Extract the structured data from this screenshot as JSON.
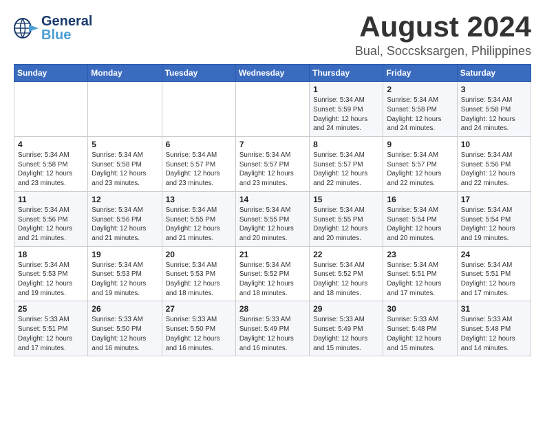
{
  "header": {
    "logo_general": "General",
    "logo_blue": "Blue",
    "main_title": "August 2024",
    "subtitle": "Bual, Soccsksargen, Philippines"
  },
  "days_of_week": [
    "Sunday",
    "Monday",
    "Tuesday",
    "Wednesday",
    "Thursday",
    "Friday",
    "Saturday"
  ],
  "weeks": [
    {
      "days": [
        {
          "number": "",
          "info": ""
        },
        {
          "number": "",
          "info": ""
        },
        {
          "number": "",
          "info": ""
        },
        {
          "number": "",
          "info": ""
        },
        {
          "number": "1",
          "info": "Sunrise: 5:34 AM\nSunset: 5:59 PM\nDaylight: 12 hours\nand 24 minutes."
        },
        {
          "number": "2",
          "info": "Sunrise: 5:34 AM\nSunset: 5:58 PM\nDaylight: 12 hours\nand 24 minutes."
        },
        {
          "number": "3",
          "info": "Sunrise: 5:34 AM\nSunset: 5:58 PM\nDaylight: 12 hours\nand 24 minutes."
        }
      ]
    },
    {
      "days": [
        {
          "number": "4",
          "info": "Sunrise: 5:34 AM\nSunset: 5:58 PM\nDaylight: 12 hours\nand 23 minutes."
        },
        {
          "number": "5",
          "info": "Sunrise: 5:34 AM\nSunset: 5:58 PM\nDaylight: 12 hours\nand 23 minutes."
        },
        {
          "number": "6",
          "info": "Sunrise: 5:34 AM\nSunset: 5:57 PM\nDaylight: 12 hours\nand 23 minutes."
        },
        {
          "number": "7",
          "info": "Sunrise: 5:34 AM\nSunset: 5:57 PM\nDaylight: 12 hours\nand 23 minutes."
        },
        {
          "number": "8",
          "info": "Sunrise: 5:34 AM\nSunset: 5:57 PM\nDaylight: 12 hours\nand 22 minutes."
        },
        {
          "number": "9",
          "info": "Sunrise: 5:34 AM\nSunset: 5:57 PM\nDaylight: 12 hours\nand 22 minutes."
        },
        {
          "number": "10",
          "info": "Sunrise: 5:34 AM\nSunset: 5:56 PM\nDaylight: 12 hours\nand 22 minutes."
        }
      ]
    },
    {
      "days": [
        {
          "number": "11",
          "info": "Sunrise: 5:34 AM\nSunset: 5:56 PM\nDaylight: 12 hours\nand 21 minutes."
        },
        {
          "number": "12",
          "info": "Sunrise: 5:34 AM\nSunset: 5:56 PM\nDaylight: 12 hours\nand 21 minutes."
        },
        {
          "number": "13",
          "info": "Sunrise: 5:34 AM\nSunset: 5:55 PM\nDaylight: 12 hours\nand 21 minutes."
        },
        {
          "number": "14",
          "info": "Sunrise: 5:34 AM\nSunset: 5:55 PM\nDaylight: 12 hours\nand 20 minutes."
        },
        {
          "number": "15",
          "info": "Sunrise: 5:34 AM\nSunset: 5:55 PM\nDaylight: 12 hours\nand 20 minutes."
        },
        {
          "number": "16",
          "info": "Sunrise: 5:34 AM\nSunset: 5:54 PM\nDaylight: 12 hours\nand 20 minutes."
        },
        {
          "number": "17",
          "info": "Sunrise: 5:34 AM\nSunset: 5:54 PM\nDaylight: 12 hours\nand 19 minutes."
        }
      ]
    },
    {
      "days": [
        {
          "number": "18",
          "info": "Sunrise: 5:34 AM\nSunset: 5:53 PM\nDaylight: 12 hours\nand 19 minutes."
        },
        {
          "number": "19",
          "info": "Sunrise: 5:34 AM\nSunset: 5:53 PM\nDaylight: 12 hours\nand 19 minutes."
        },
        {
          "number": "20",
          "info": "Sunrise: 5:34 AM\nSunset: 5:53 PM\nDaylight: 12 hours\nand 18 minutes."
        },
        {
          "number": "21",
          "info": "Sunrise: 5:34 AM\nSunset: 5:52 PM\nDaylight: 12 hours\nand 18 minutes."
        },
        {
          "number": "22",
          "info": "Sunrise: 5:34 AM\nSunset: 5:52 PM\nDaylight: 12 hours\nand 18 minutes."
        },
        {
          "number": "23",
          "info": "Sunrise: 5:34 AM\nSunset: 5:51 PM\nDaylight: 12 hours\nand 17 minutes."
        },
        {
          "number": "24",
          "info": "Sunrise: 5:34 AM\nSunset: 5:51 PM\nDaylight: 12 hours\nand 17 minutes."
        }
      ]
    },
    {
      "days": [
        {
          "number": "25",
          "info": "Sunrise: 5:33 AM\nSunset: 5:51 PM\nDaylight: 12 hours\nand 17 minutes."
        },
        {
          "number": "26",
          "info": "Sunrise: 5:33 AM\nSunset: 5:50 PM\nDaylight: 12 hours\nand 16 minutes."
        },
        {
          "number": "27",
          "info": "Sunrise: 5:33 AM\nSunset: 5:50 PM\nDaylight: 12 hours\nand 16 minutes."
        },
        {
          "number": "28",
          "info": "Sunrise: 5:33 AM\nSunset: 5:49 PM\nDaylight: 12 hours\nand 16 minutes."
        },
        {
          "number": "29",
          "info": "Sunrise: 5:33 AM\nSunset: 5:49 PM\nDaylight: 12 hours\nand 15 minutes."
        },
        {
          "number": "30",
          "info": "Sunrise: 5:33 AM\nSunset: 5:48 PM\nDaylight: 12 hours\nand 15 minutes."
        },
        {
          "number": "31",
          "info": "Sunrise: 5:33 AM\nSunset: 5:48 PM\nDaylight: 12 hours\nand 14 minutes."
        }
      ]
    }
  ]
}
